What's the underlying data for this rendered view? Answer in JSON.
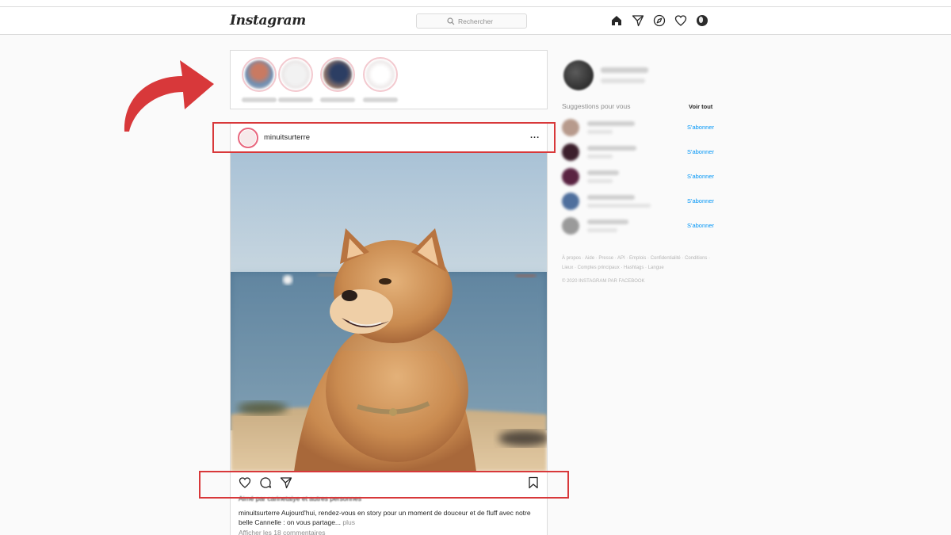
{
  "app": {
    "logo": "Instagram"
  },
  "search": {
    "placeholder": "Rechercher"
  },
  "nav_icons": [
    "home-icon",
    "direct-icon",
    "explore-icon",
    "activity-icon",
    "profile-icon"
  ],
  "post": {
    "username": "minuitsurterre",
    "more_label": "...",
    "liked_by": "Aimé par carinetaiye et autres personnes",
    "caption_user": "minuitsurterre",
    "caption_text": " Aujourd'hui, rendez-vous en story pour un moment de douceur et de fluff avec notre belle Cannelle : on vous partage... ",
    "caption_more": "plus",
    "comments_link": "Afficher les 18 commentaires"
  },
  "sidebar": {
    "suggestions_title": "Suggestions pour vous",
    "see_all": "Voir tout",
    "follow_label": "S'abonner",
    "footer_links": "À propos · Aide · Presse · API · Emplois · Confidentialité · Conditions · Lieux · Comptes principaux · Hashtags · Langue",
    "copyright": "© 2020 INSTAGRAM PAR FACEBOOK"
  },
  "colors": {
    "accent_blue": "#0095f6",
    "annotation_red": "#d8383a",
    "border": "#dbdbdb"
  }
}
